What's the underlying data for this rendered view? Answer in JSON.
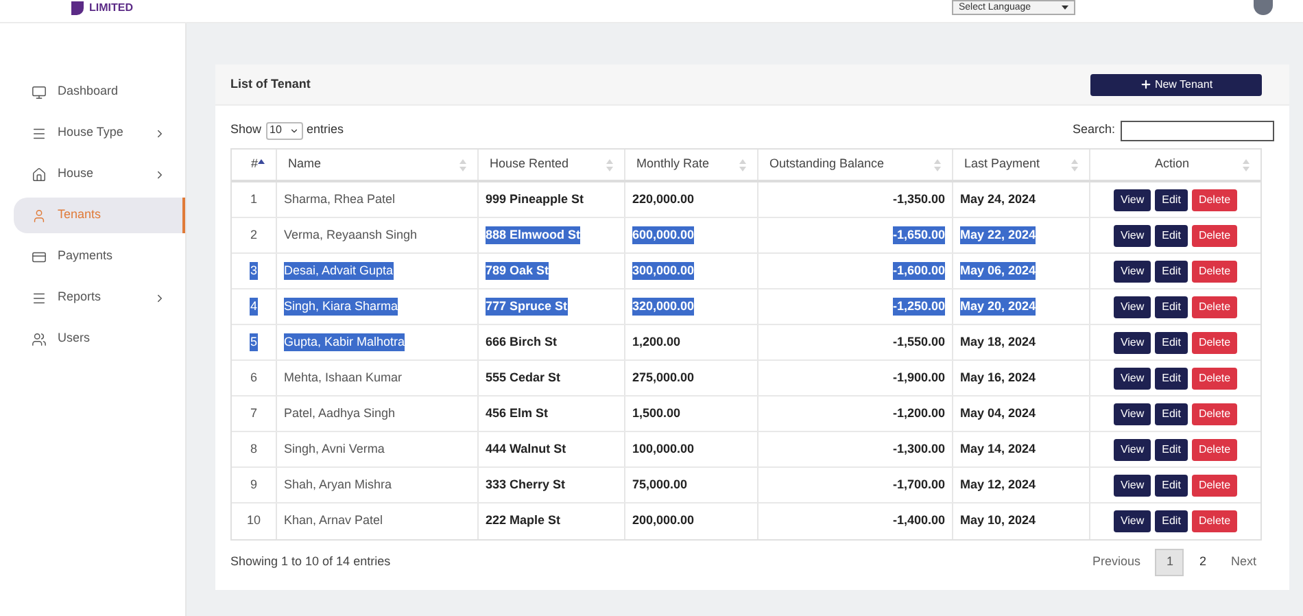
{
  "header": {
    "logo_text": "LIMITED",
    "language_select": "Select Language"
  },
  "sidebar": {
    "items": [
      {
        "label": "Dashboard",
        "submenu": false,
        "selected": false
      },
      {
        "label": "House Type",
        "submenu": true,
        "selected": false
      },
      {
        "label": "House",
        "submenu": true,
        "selected": false
      },
      {
        "label": "Tenants",
        "submenu": false,
        "selected": true
      },
      {
        "label": "Payments",
        "submenu": false,
        "selected": false
      },
      {
        "label": "Reports",
        "submenu": true,
        "selected": false
      },
      {
        "label": "Users",
        "submenu": false,
        "selected": false
      }
    ]
  },
  "card": {
    "title": "List of Tenant",
    "new_button": "New Tenant",
    "show_label": "Show",
    "page_size": "10",
    "entries_label": "entries",
    "search_label": "Search:",
    "columns": [
      {
        "label": "#",
        "sorted": true
      },
      {
        "label": "Name",
        "sorted": false
      },
      {
        "label": "House Rented",
        "sorted": false
      },
      {
        "label": "Monthly Rate",
        "sorted": false
      },
      {
        "label": "Outstanding Balance",
        "sorted": false
      },
      {
        "label": "Last Payment",
        "sorted": false
      },
      {
        "label": "Action",
        "sorted": false
      }
    ],
    "rows": [
      {
        "cells": [
          {
            "text": "1",
            "highlighted": false
          },
          {
            "text": "Sharma, Rhea Patel",
            "highlighted": false
          },
          {
            "text": "999 Pineapple St",
            "highlighted": false
          },
          {
            "text": "220,000.00",
            "highlighted": false
          },
          {
            "text": "-1,350.00",
            "highlighted": false
          },
          {
            "text": "May 24, 2024",
            "highlighted": false
          }
        ],
        "actions": [
          "View",
          "Edit",
          "Delete"
        ]
      },
      {
        "cells": [
          {
            "text": "2",
            "highlighted": false
          },
          {
            "text": "Verma, Reyaansh Singh",
            "highlighted": false
          },
          {
            "text": "888 Elmwood St",
            "highlighted": true
          },
          {
            "text": "600,000.00",
            "highlighted": true
          },
          {
            "text": "-1,650.00",
            "highlighted": true
          },
          {
            "text": "May 22, 2024",
            "highlighted": true
          }
        ],
        "actions": [
          "View",
          "Edit",
          "Delete"
        ]
      },
      {
        "cells": [
          {
            "text": "3",
            "highlighted": true
          },
          {
            "text": "Desai, Advait Gupta",
            "highlighted": true
          },
          {
            "text": "789 Oak St",
            "highlighted": true
          },
          {
            "text": "300,000.00",
            "highlighted": true
          },
          {
            "text": "-1,600.00",
            "highlighted": true
          },
          {
            "text": "May 06, 2024",
            "highlighted": true
          }
        ],
        "actions": [
          "View",
          "Edit",
          "Delete"
        ]
      },
      {
        "cells": [
          {
            "text": "4",
            "highlighted": true
          },
          {
            "text": "Singh, Kiara Sharma",
            "highlighted": true
          },
          {
            "text": "777 Spruce St",
            "highlighted": true
          },
          {
            "text": "320,000.00",
            "highlighted": true
          },
          {
            "text": "-1,250.00",
            "highlighted": true
          },
          {
            "text": "May 20, 2024",
            "highlighted": true
          }
        ],
        "actions": [
          "View",
          "Edit",
          "Delete"
        ]
      },
      {
        "cells": [
          {
            "text": "5",
            "highlighted": true
          },
          {
            "text": "Gupta, Kabir Malhotra",
            "highlighted": true
          },
          {
            "text": "666 Birch St",
            "highlighted": false
          },
          {
            "text": "1,200.00",
            "highlighted": false
          },
          {
            "text": "-1,550.00",
            "highlighted": false
          },
          {
            "text": "May 18, 2024",
            "highlighted": false
          }
        ],
        "actions": [
          "View",
          "Edit",
          "Delete"
        ]
      },
      {
        "cells": [
          {
            "text": "6",
            "highlighted": false
          },
          {
            "text": "Mehta, Ishaan Kumar",
            "highlighted": false
          },
          {
            "text": "555 Cedar St",
            "highlighted": false
          },
          {
            "text": "275,000.00",
            "highlighted": false
          },
          {
            "text": "-1,900.00",
            "highlighted": false
          },
          {
            "text": "May 16, 2024",
            "highlighted": false
          }
        ],
        "actions": [
          "View",
          "Edit",
          "Delete"
        ]
      },
      {
        "cells": [
          {
            "text": "7",
            "highlighted": false
          },
          {
            "text": "Patel, Aadhya Singh",
            "highlighted": false
          },
          {
            "text": "456 Elm St",
            "highlighted": false
          },
          {
            "text": "1,500.00",
            "highlighted": false
          },
          {
            "text": "-1,200.00",
            "highlighted": false
          },
          {
            "text": "May 04, 2024",
            "highlighted": false
          }
        ],
        "actions": [
          "View",
          "Edit",
          "Delete"
        ]
      },
      {
        "cells": [
          {
            "text": "8",
            "highlighted": false
          },
          {
            "text": "Singh, Avni Verma",
            "highlighted": false
          },
          {
            "text": "444 Walnut St",
            "highlighted": false
          },
          {
            "text": "100,000.00",
            "highlighted": false
          },
          {
            "text": "-1,300.00",
            "highlighted": false
          },
          {
            "text": "May 14, 2024",
            "highlighted": false
          }
        ],
        "actions": [
          "View",
          "Edit",
          "Delete"
        ]
      },
      {
        "cells": [
          {
            "text": "9",
            "highlighted": false
          },
          {
            "text": "Shah, Aryan Mishra",
            "highlighted": false
          },
          {
            "text": "333 Cherry St",
            "highlighted": false
          },
          {
            "text": "75,000.00",
            "highlighted": false
          },
          {
            "text": "-1,700.00",
            "highlighted": false
          },
          {
            "text": "May 12, 2024",
            "highlighted": false
          }
        ],
        "actions": [
          "View",
          "Edit",
          "Delete"
        ]
      },
      {
        "cells": [
          {
            "text": "10",
            "highlighted": false
          },
          {
            "text": "Khan, Arnav Patel",
            "highlighted": false
          },
          {
            "text": "222 Maple St",
            "highlighted": false
          },
          {
            "text": "200,000.00",
            "highlighted": false
          },
          {
            "text": "-1,400.00",
            "highlighted": false
          },
          {
            "text": "May 10, 2024",
            "highlighted": false
          }
        ],
        "actions": [
          "View",
          "Edit",
          "Delete"
        ]
      }
    ],
    "info": "Showing 1 to 10 of 14 entries",
    "pagination": [
      {
        "label": "Previous",
        "kind": "nav",
        "selected": false
      },
      {
        "label": "1",
        "kind": "page",
        "selected": true
      },
      {
        "label": "2",
        "kind": "page",
        "selected": false
      },
      {
        "label": "Next",
        "kind": "nav",
        "selected": false
      }
    ]
  }
}
